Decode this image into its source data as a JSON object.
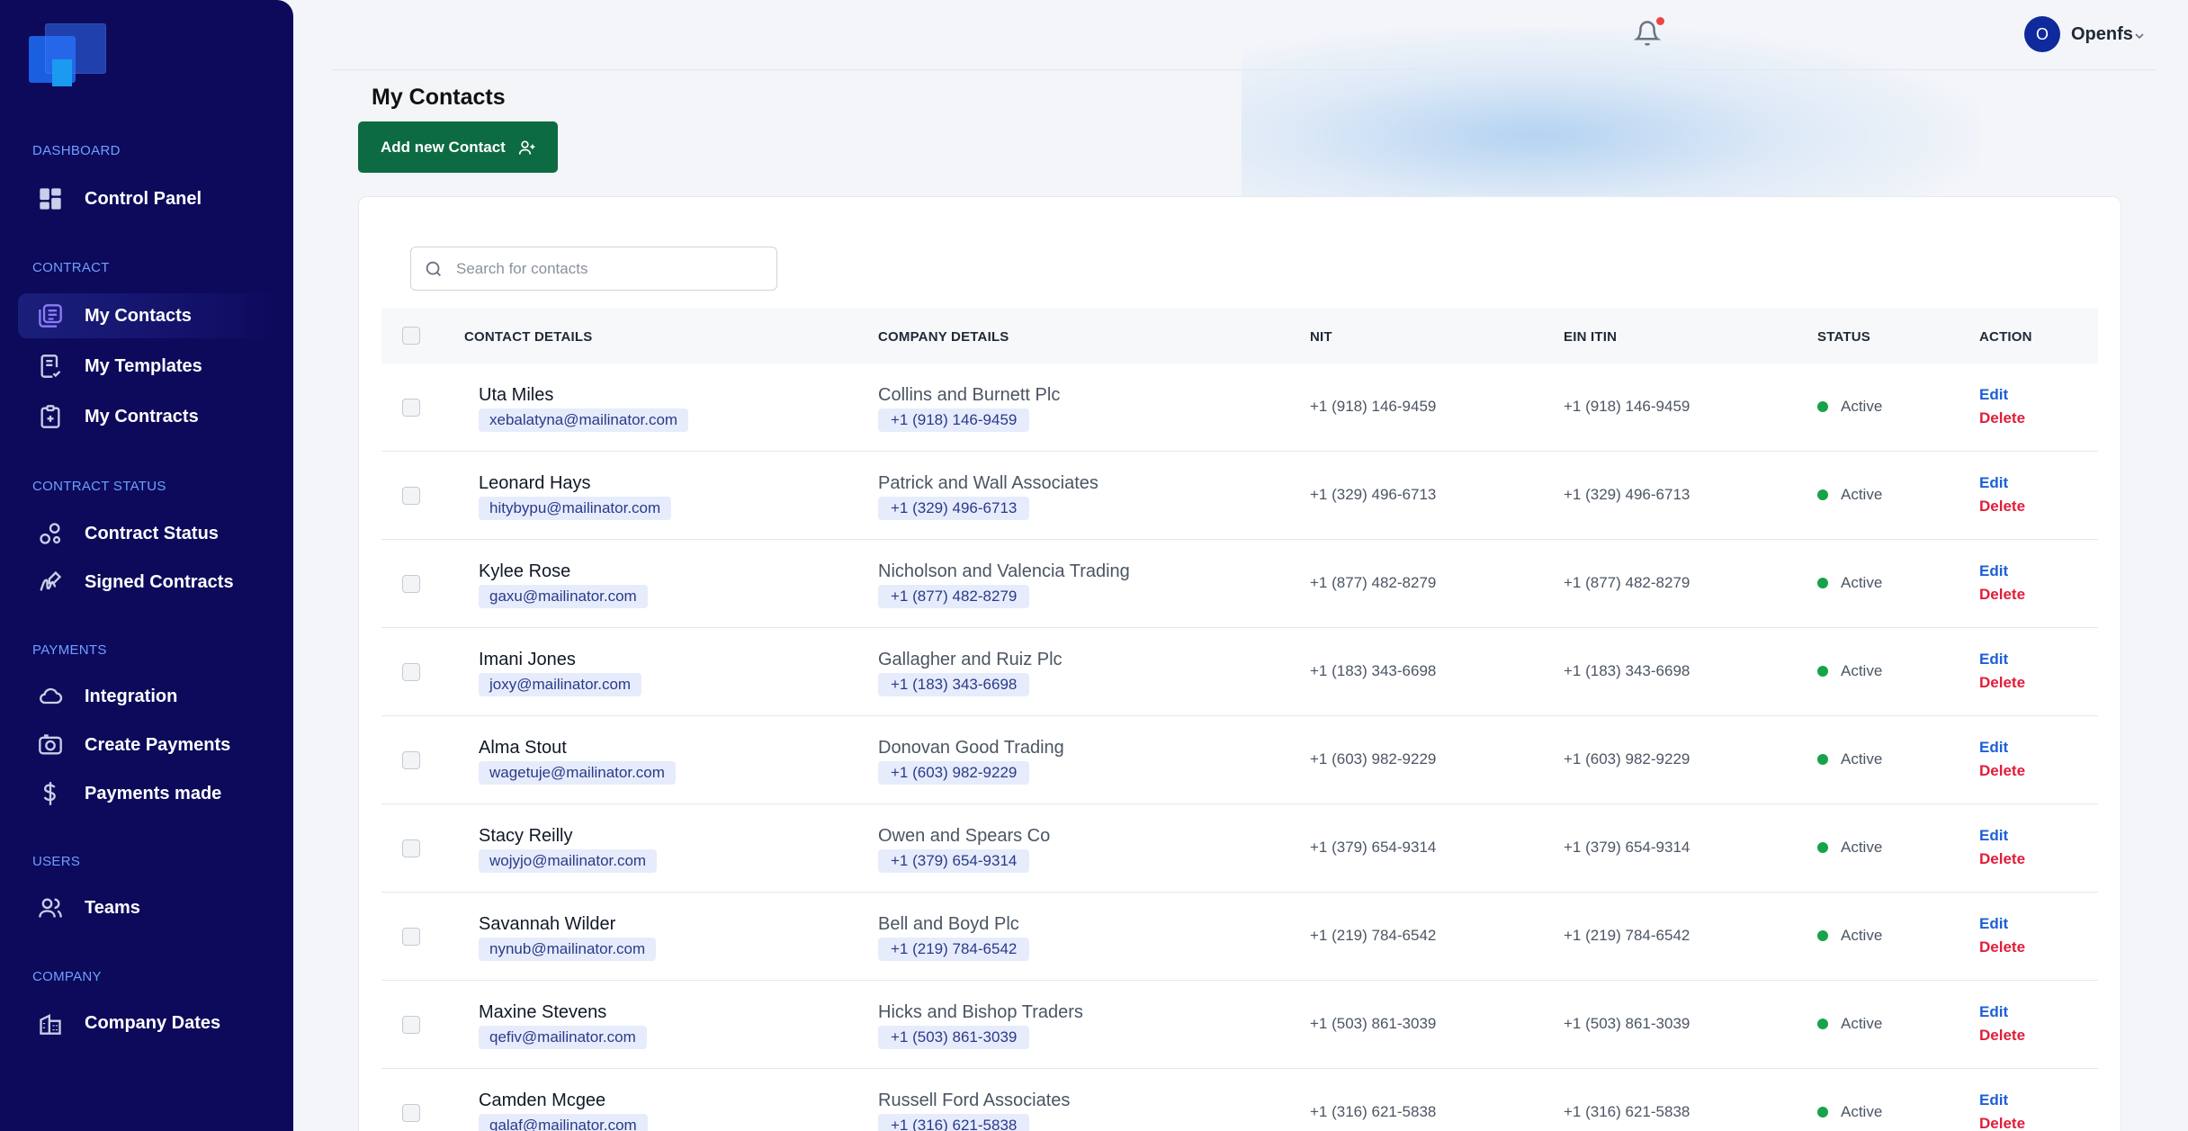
{
  "sidebar": {
    "sections": [
      {
        "label": "DASHBOARD"
      },
      {
        "label": "CONTRACT"
      },
      {
        "label": "CONTRACT STATUS"
      },
      {
        "label": "PAYMENTS"
      },
      {
        "label": "USERS"
      },
      {
        "label": "COMPANY"
      }
    ],
    "items": [
      {
        "label": "Control Panel",
        "icon": "grid-icon"
      },
      {
        "label": "My Contacts",
        "icon": "contacts-icon",
        "active": true
      },
      {
        "label": "My Templates",
        "icon": "template-icon"
      },
      {
        "label": "My Contracts",
        "icon": "clipboard-icon"
      },
      {
        "label": "Contract Status",
        "icon": "status-icon"
      },
      {
        "label": "Signed Contracts",
        "icon": "signature-icon"
      },
      {
        "label": "Integration",
        "icon": "cloud-icon"
      },
      {
        "label": "Create Payments",
        "icon": "camera-money-icon"
      },
      {
        "label": "Payments made",
        "icon": "dollar-icon"
      },
      {
        "label": "Teams",
        "icon": "users-icon"
      },
      {
        "label": "Company Dates",
        "icon": "building-icon"
      }
    ]
  },
  "topbar": {
    "avatar_initial": "O",
    "username": "Openfs"
  },
  "page": {
    "title": "My Contacts",
    "add_button_label": "Add new Contact",
    "search_placeholder": "Search for contacts"
  },
  "table": {
    "columns": [
      "CONTACT DETAILS",
      "COMPANY DETAILS",
      "NIT",
      "EIN ITIN",
      "STATUS",
      "ACTION"
    ],
    "edit_label": "Edit",
    "delete_label": "Delete",
    "rows": [
      {
        "name": "Uta Miles",
        "email": "xebalatyna@mailinator.com",
        "company": "Collins and Burnett Plc",
        "phone": "+1 (918) 146-9459",
        "nit": "+1 (918) 146-9459",
        "ein": "+1 (918) 146-9459",
        "status": "Active"
      },
      {
        "name": "Leonard Hays",
        "email": "hitybypu@mailinator.com",
        "company": "Patrick and Wall Associates",
        "phone": "+1 (329) 496-6713",
        "nit": "+1 (329) 496-6713",
        "ein": "+1 (329) 496-6713",
        "status": "Active"
      },
      {
        "name": "Kylee Rose",
        "email": "gaxu@mailinator.com",
        "company": "Nicholson and Valencia Trading",
        "phone": "+1 (877) 482-8279",
        "nit": "+1 (877) 482-8279",
        "ein": "+1 (877) 482-8279",
        "status": "Active"
      },
      {
        "name": "Imani Jones",
        "email": "joxy@mailinator.com",
        "company": "Gallagher and Ruiz Plc",
        "phone": "+1 (183) 343-6698",
        "nit": "+1 (183) 343-6698",
        "ein": "+1 (183) 343-6698",
        "status": "Active"
      },
      {
        "name": "Alma Stout",
        "email": "wagetuje@mailinator.com",
        "company": "Donovan Good Trading",
        "phone": "+1 (603) 982-9229",
        "nit": "+1 (603) 982-9229",
        "ein": "+1 (603) 982-9229",
        "status": "Active"
      },
      {
        "name": "Stacy Reilly",
        "email": "wojyjo@mailinator.com",
        "company": "Owen and Spears Co",
        "phone": "+1 (379) 654-9314",
        "nit": "+1 (379) 654-9314",
        "ein": "+1 (379) 654-9314",
        "status": "Active"
      },
      {
        "name": "Savannah Wilder",
        "email": "nynub@mailinator.com",
        "company": "Bell and Boyd Plc",
        "phone": "+1 (219) 784-6542",
        "nit": "+1 (219) 784-6542",
        "ein": "+1 (219) 784-6542",
        "status": "Active"
      },
      {
        "name": "Maxine Stevens",
        "email": "qefiv@mailinator.com",
        "company": "Hicks and Bishop Traders",
        "phone": "+1 (503) 861-3039",
        "nit": "+1 (503) 861-3039",
        "ein": "+1 (503) 861-3039",
        "status": "Active"
      },
      {
        "name": "Camden Mcgee",
        "email": "galaf@mailinator.com",
        "company": "Russell Ford Associates",
        "phone": "+1 (316) 621-5838",
        "nit": "+1 (316) 621-5838",
        "ein": "+1 (316) 621-5838",
        "status": "Active"
      }
    ]
  },
  "colors": {
    "sidebar_bg": "#0d0a5c",
    "accent_green": "#0c6b43",
    "link_blue": "#1d5fd6",
    "delete_red": "#e11d3a",
    "status_green": "#16a34a"
  }
}
